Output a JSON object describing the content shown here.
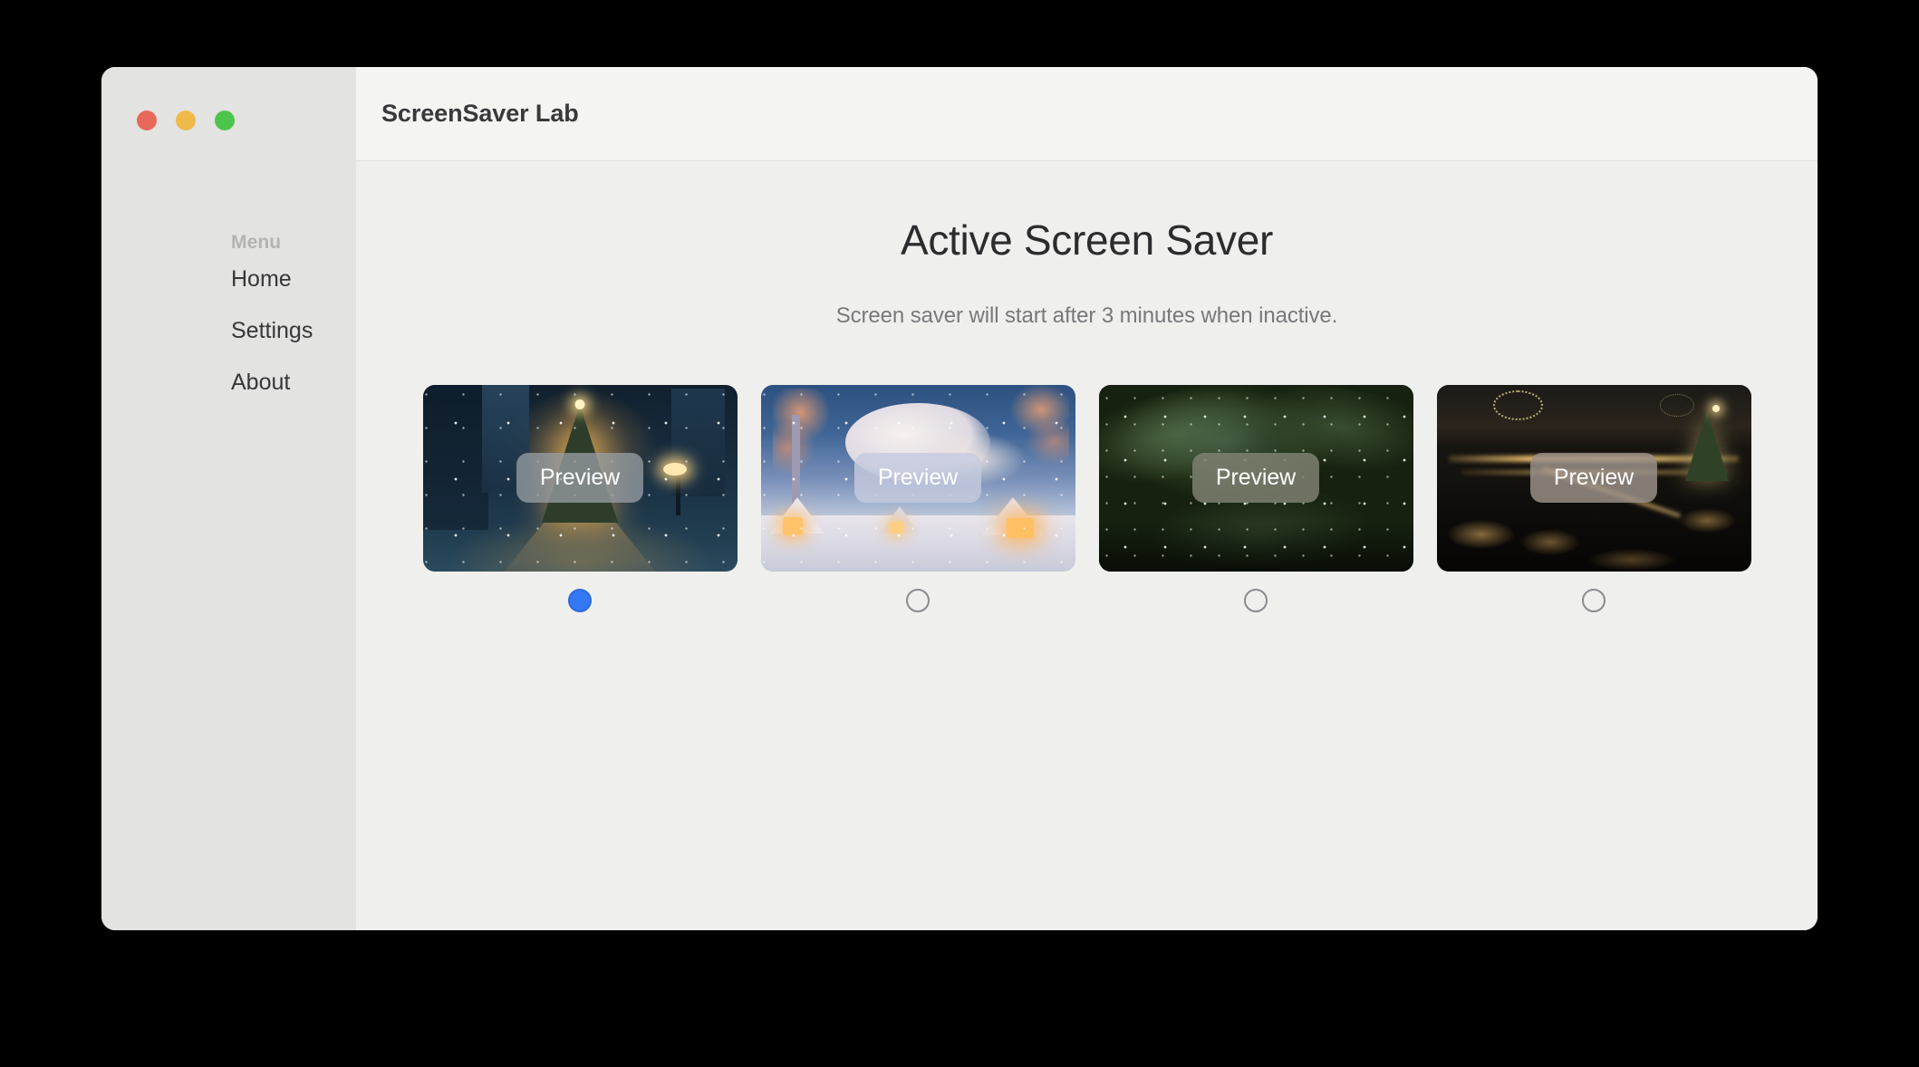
{
  "window": {
    "traffic_lights": [
      {
        "name": "close",
        "color": "#e8695c"
      },
      {
        "name": "minimize",
        "color": "#f0ba4b"
      },
      {
        "name": "zoom",
        "color": "#4ec44c"
      }
    ],
    "titlebar": {
      "title": "ScreenSaver Lab"
    }
  },
  "sidebar": {
    "section_label": "Menu",
    "toggle_icon": "sidebar-toggle-icon",
    "items": [
      {
        "label": "Home",
        "selected": false
      },
      {
        "label": "Settings",
        "selected": false
      },
      {
        "label": "About",
        "selected": false
      }
    ]
  },
  "main": {
    "page_title": "Active Screen Saver",
    "page_subtitle": "Screen saver will start after 3 minutes when inactive.",
    "inactive_minutes": 3,
    "savers": [
      {
        "preview_label": "Preview",
        "scene": "snowy-city-street-with-christmas-tree",
        "selected": true,
        "pill_color": "#9aa0a6"
      },
      {
        "preview_label": "Preview",
        "scene": "anime-winter-village-at-dusk",
        "selected": false,
        "pill_color": "#c2c8de"
      },
      {
        "preview_label": "Preview",
        "scene": "snowy-pine-branches",
        "selected": false,
        "pill_color": "#7e8070"
      },
      {
        "preview_label": "Preview",
        "scene": "aerial-night-village-lights",
        "selected": false,
        "pill_color": "#9b9088"
      }
    ],
    "selected_index": 0,
    "accent_color": "#3478f6"
  }
}
